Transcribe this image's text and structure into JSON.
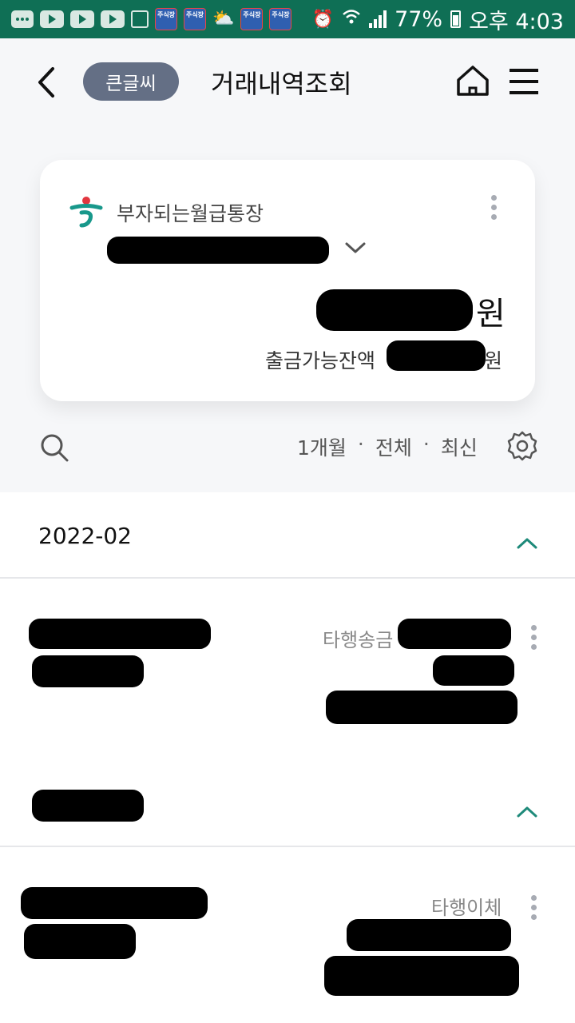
{
  "status_bar": {
    "app_badge_label": "주식장",
    "battery": "77%",
    "time": "오후 4:03"
  },
  "header": {
    "big_font_label": "큰글씨",
    "title": "거래내역조회"
  },
  "account": {
    "name": "부자되는월급통장",
    "balance_unit": "원",
    "available_label": "출금가능잔액",
    "available_unit": "원"
  },
  "filter": {
    "period": "1개월",
    "type": "전체",
    "order": "최신",
    "separator": "·"
  },
  "section": {
    "month": "2022-02"
  },
  "transactions": [
    {
      "type": "타행송금"
    },
    {
      "type": "타행이체"
    }
  ],
  "colors": {
    "status_bar": "#0f6f55",
    "accent": "#1e8a7a",
    "big_font_badge": "#646f85",
    "bank_logo": "#18988b",
    "bank_logo_red": "#e2363f"
  }
}
